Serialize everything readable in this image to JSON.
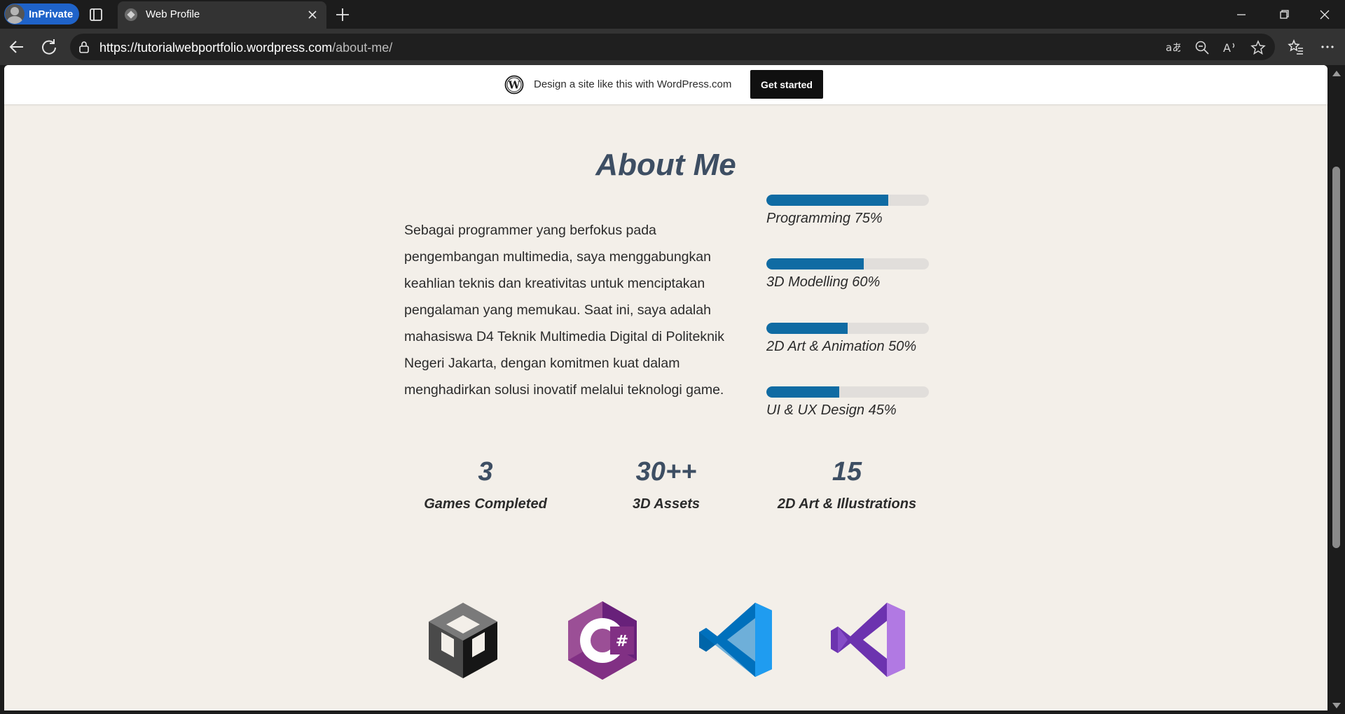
{
  "browser": {
    "profile_label": "InPrivate",
    "tab_title": "Web Profile",
    "url_host": "https://tutorialwebportfolio.wordpress.com",
    "url_path": "/about-me/"
  },
  "wp_banner": {
    "message": "Design a site like this with WordPress.com",
    "cta_label": "Get started"
  },
  "page": {
    "title": "About Me",
    "about_text": "Sebagai programmer yang berfokus pada pengembangan multimedia, saya menggabungkan keahlian teknis dan kreativitas untuk menciptakan pengalaman yang memukau. Saat ini, saya adalah mahasiswa D4 Teknik Multimedia Digital di Politeknik Negeri Jakarta, dengan komitmen kuat dalam menghadirkan solusi inovatif melalui teknologi game.",
    "skills": [
      {
        "label": "Programming 75%",
        "level": 0.75
      },
      {
        "label": "3D Modelling 60%",
        "level": 0.6
      },
      {
        "label": "2D Art & Animation 50%",
        "level": 0.5
      },
      {
        "label": "UI & UX Design 45%",
        "level": 0.45
      }
    ],
    "stats": [
      {
        "value": "3",
        "caption": "Games Completed"
      },
      {
        "value": "30++",
        "caption": "3D Assets"
      },
      {
        "value": "15",
        "caption": "2D Art & Illustrations"
      }
    ],
    "tech_icons": [
      "unity-icon",
      "csharp-icon",
      "vscode-icon",
      "visual-studio-icon"
    ]
  },
  "colors": {
    "page_bg": "#f3efe9",
    "heading": "#3d4e63",
    "skill_fill": "#0f6ba3",
    "skill_track": "#e1dedb",
    "inprivate": "#1f63c9"
  }
}
